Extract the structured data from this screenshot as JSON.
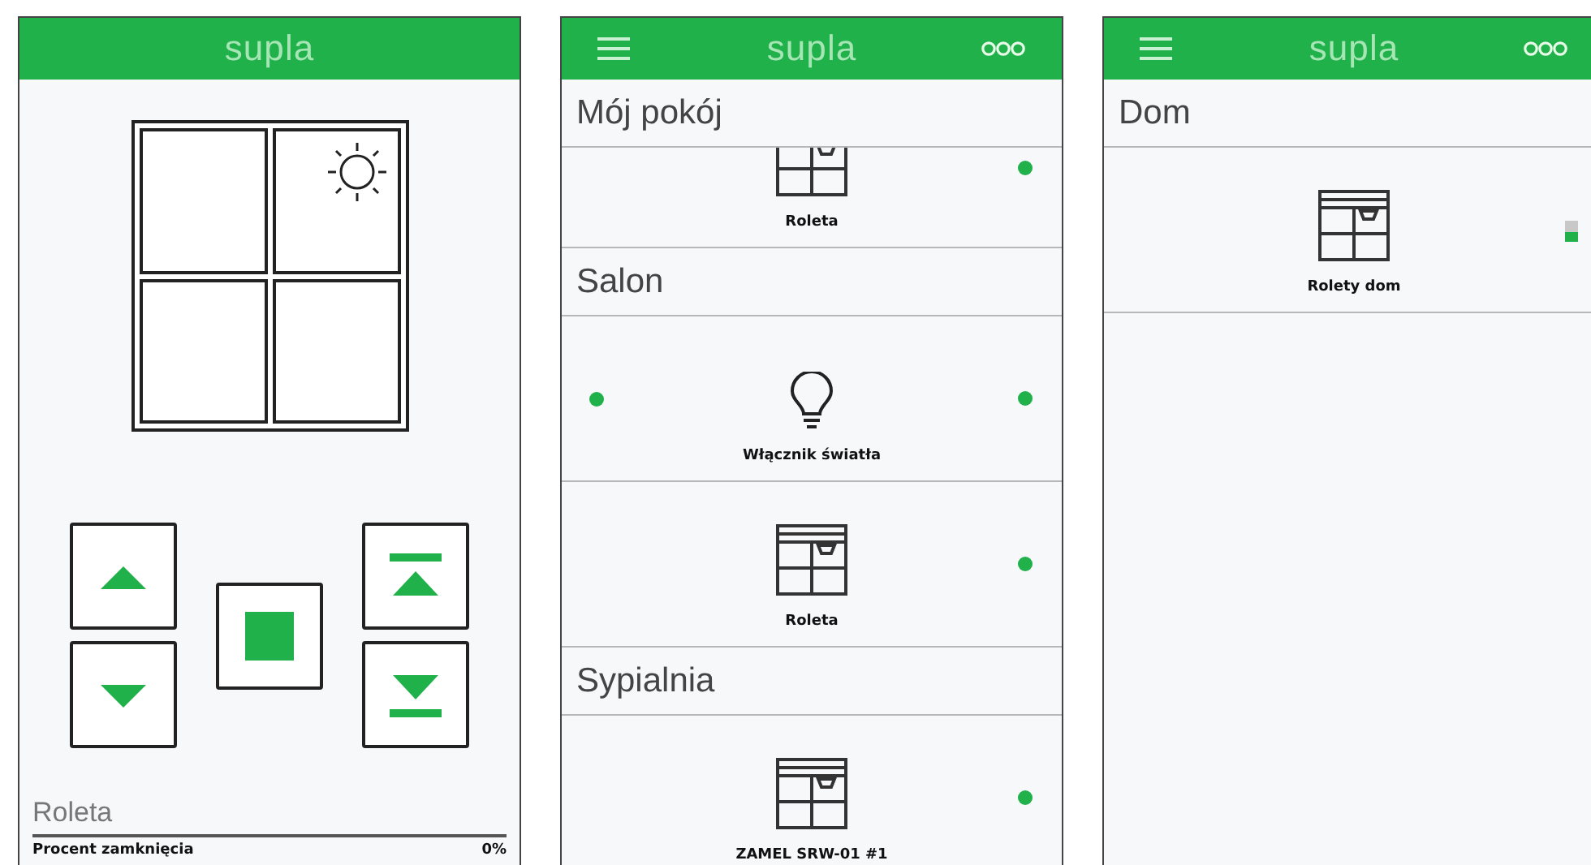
{
  "screens": [
    {
      "kind": "control",
      "header": {
        "title": "supla"
      },
      "shutter": {
        "level": 0
      },
      "buttons": [
        {
          "kind": "up"
        },
        {
          "kind": "down"
        },
        {
          "kind": "stop"
        },
        {
          "kind": "top"
        },
        {
          "kind": "bottom"
        }
      ],
      "name": "Roleta",
      "reading_label": "Procent zamknięcia",
      "reading": "0%"
    },
    {
      "kind": "list",
      "header": {
        "title": "supla",
        "menu": true,
        "more": true
      },
      "sections": [
        {
          "title": "Mój pokój",
          "channels": [
            {
              "kind": "shutter",
              "label": "Roleta",
              "cut": true,
              "online": true
            }
          ]
        },
        {
          "title": "Salon",
          "channels": [
            {
              "kind": "light",
              "label": "Włącznik światła",
              "cut": false,
              "online": true,
              "on": true
            },
            {
              "kind": "shutter",
              "label": "Roleta",
              "cut": false,
              "online": true
            }
          ]
        },
        {
          "title": "Sypialnia",
          "channels": [
            {
              "kind": "shutter",
              "label": "ZAMEL SRW-01 #1",
              "cut": false,
              "online": true
            }
          ]
        }
      ]
    },
    {
      "kind": "list",
      "header": {
        "title": "supla",
        "menu": true,
        "more": true
      },
      "sections": [
        {
          "title": "Dom",
          "channels": [
            {
              "kind": "group",
              "label": "Rolety dom",
              "level": 0.5
            }
          ]
        }
      ]
    }
  ]
}
